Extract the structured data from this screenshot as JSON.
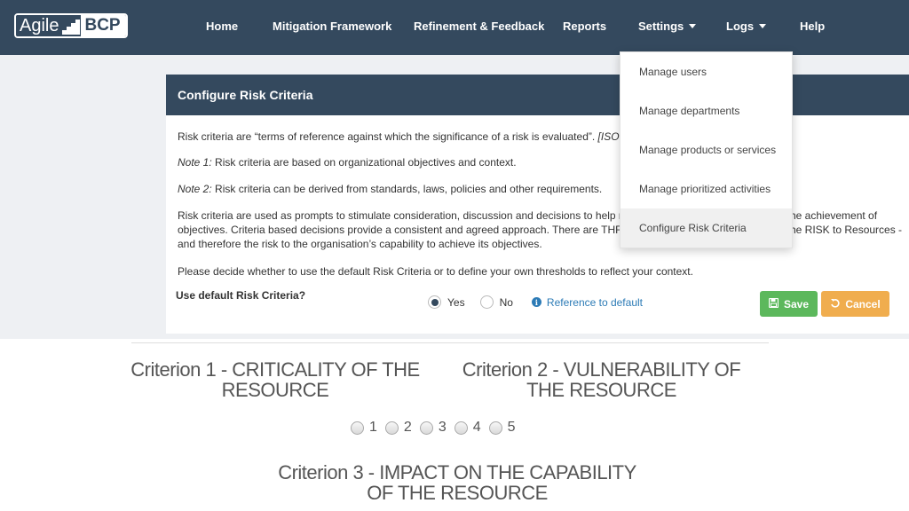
{
  "logo": {
    "part1": "Agile",
    "part2": "BCP"
  },
  "nav": {
    "home": "Home",
    "mitigation": "Mitigation Framework",
    "refinement": "Refinement & Feedback",
    "reports": "Reports",
    "settings": "Settings",
    "logs": "Logs",
    "help": "Help"
  },
  "settings_menu": {
    "items": [
      "Manage users",
      "Manage departments",
      "Manage products or services",
      "Manage prioritized activities",
      "Configure Risk Criteria"
    ],
    "active": "Configure Risk Criteria"
  },
  "panel": {
    "title": "Configure Risk Criteria",
    "p1": "Risk criteria are “terms of reference against which the significance of a risk is evaluated”. ",
    "p1_cite": "[ISO c",
    "note1_label": "Note 1:",
    "note1_text": " Risk criteria are based on organizational objectives and context.",
    "note2_label": "Note 2:",
    "note2_text": " Risk criteria can be derived from standards, laws, policies and other requirements.",
    "p4_line1": "Risk criteria are used as prompts to stimulate consideration, discussion and decisions to help r",
    "p4_line1_end": "he achievement of",
    "p4_line2": "objectives. Criteria based decisions provide a consistent and agreed approach. There are THRE",
    "p4_line2_end": "he RISK to Resources -",
    "p4_line3": "and therefore the risk to the organisation’s capability to achieve its objectives.",
    "p5": "Please decide whether to use the default Risk Criteria or to define your own thresholds to reflect your context.",
    "use_default_label": "Use default Risk Criteria?",
    "yes_label": "Yes",
    "no_label": "No",
    "selected": "Yes",
    "reference_link": "Reference to default",
    "save_label": "Save",
    "cancel_label": "Cancel"
  },
  "criteria": {
    "c1_line1": "Criterion 1 - CRITICALITY OF THE",
    "c1_line2": "RESOURCE",
    "c2_line1": "Criterion 2 - VULNERABILITY OF",
    "c2_line2": "THE RESOURCE",
    "c3_line1": "Criterion 3 - IMPACT ON THE  CAPABILITY",
    "c3_line2": "OF THE RESOURCE"
  },
  "rating": {
    "options": [
      "1",
      "2",
      "3",
      "4",
      "5"
    ]
  },
  "colors": {
    "navbar": "#34495e",
    "save": "#5cb85c",
    "cancel": "#f0ad4e",
    "link": "#2c7bb6"
  }
}
